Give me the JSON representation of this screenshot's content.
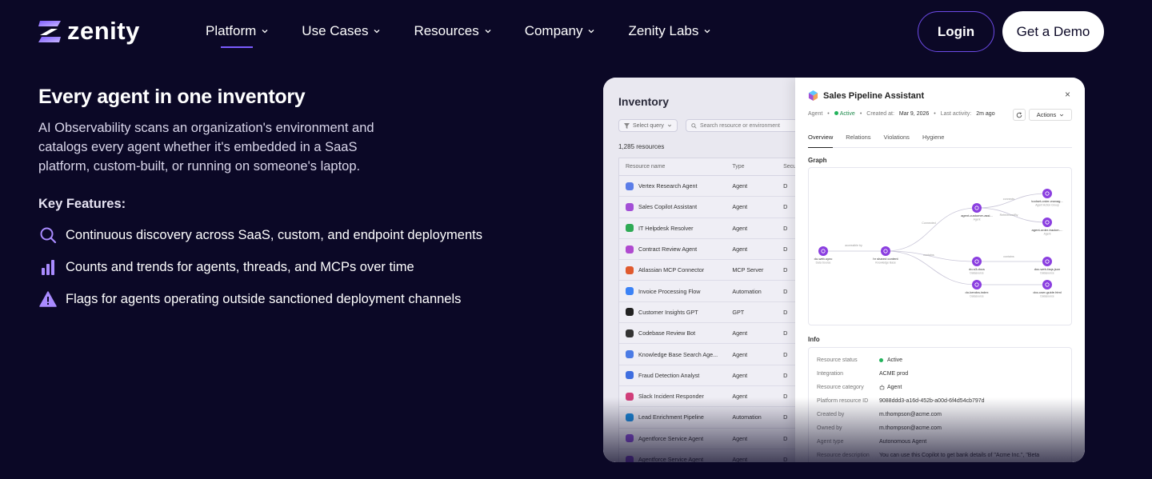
{
  "brand": {
    "name": "zenity"
  },
  "nav": {
    "items": [
      {
        "label": "Platform"
      },
      {
        "label": "Use Cases"
      },
      {
        "label": "Resources"
      },
      {
        "label": "Company"
      },
      {
        "label": "Zenity Labs"
      }
    ],
    "login_label": "Login",
    "demo_label": "Get a Demo"
  },
  "hero": {
    "title": "Every agent in one inventory",
    "description": "AI Observability scans an organization's environment and catalogs every agent whether it's embedded in a SaaS platform, custom-built, or running on someone's laptop.",
    "key_features_title": "Key Features:",
    "features": [
      {
        "icon": "search-icon",
        "text": "Continuous discovery across SaaS, custom, and endpoint deployments"
      },
      {
        "icon": "bar-chart-icon",
        "text": "Counts and trends for agents, threads, and MCPs over time"
      },
      {
        "icon": "warning-icon",
        "text": "Flags for agents operating outside sanctioned deployment channels"
      }
    ]
  },
  "inventory": {
    "title": "Inventory",
    "filter_label": "Select query",
    "search_placeholder": "Search resource or environment",
    "count": "1,285 resources",
    "columns": {
      "name": "Resource name",
      "type": "Type",
      "sec": "Secu"
    },
    "rows": [
      {
        "name": "Vertex Research Agent",
        "type": "Agent",
        "sec": "D",
        "color": "#5b7de8"
      },
      {
        "name": "Sales Copilot Assistant",
        "type": "Agent",
        "sec": "D",
        "color": "#a34fd6"
      },
      {
        "name": "IT Helpdesk Resolver",
        "type": "Agent",
        "sec": "D",
        "color": "#2faa55"
      },
      {
        "name": "Contract Review Agent",
        "type": "Agent",
        "sec": "D",
        "color": "#b04ad0"
      },
      {
        "name": "Atlassian MCP Connector",
        "type": "MCP Server",
        "sec": "D",
        "color": "#e05a2e"
      },
      {
        "name": "Invoice Processing Flow",
        "type": "Automation",
        "sec": "D",
        "color": "#3b82f6"
      },
      {
        "name": "Customer Insights GPT",
        "type": "GPT",
        "sec": "D",
        "color": "#222222"
      },
      {
        "name": "Codebase Review Bot",
        "type": "Agent",
        "sec": "D",
        "color": "#333333"
      },
      {
        "name": "Knowledge Base Search Age...",
        "type": "Agent",
        "sec": "D",
        "color": "#4b7be5"
      },
      {
        "name": "Fraud Detection Analyst",
        "type": "Agent",
        "sec": "D",
        "color": "#3f6ee0"
      },
      {
        "name": "Slack Incident Responder",
        "type": "Agent",
        "sec": "D",
        "color": "#d13f7a"
      },
      {
        "name": "Lead Enrichment Pipeline",
        "type": "Automation",
        "sec": "D",
        "color": "#1c8adb"
      },
      {
        "name": "Agentforce Service Agent",
        "type": "Agent",
        "sec": "D",
        "color": "#8a4fd8"
      },
      {
        "name": "Agentforce Service Agent",
        "type": "Agent",
        "sec": "D",
        "color": "#8a4fd8"
      }
    ]
  },
  "detail": {
    "title": "Sales Pipeline Assistant",
    "close": "×",
    "meta": {
      "kind": "Agent",
      "status": "Active",
      "created_label": "Created at:",
      "created": "Mar 9, 2026",
      "activity_label": "Last activity:",
      "activity": "2m ago"
    },
    "actions_label": "Actions",
    "tabs": [
      "Overview",
      "Relations",
      "Violations",
      "Hygiene"
    ],
    "graph_label": "Graph",
    "graph_nodes": [
      {
        "title": "do-web-sync",
        "sub": "Data Source"
      },
      {
        "title": "hr shared content",
        "sub": "Knowledge Base"
      },
      {
        "title": "agent-customer-assi...",
        "sub": "Agent"
      },
      {
        "title": "toolset-order-manag...",
        "sub": "Agent Action Group"
      },
      {
        "title": "agent-order-tracker-...",
        "sub": "Agent"
      },
      {
        "title": "do-s3-docs",
        "sub": "Datasource"
      },
      {
        "title": "doc-web-faqs.json",
        "sub": "Datasource"
      },
      {
        "title": "do-kendra-index",
        "sub": "Datasource"
      },
      {
        "title": "doc-user-guide.html",
        "sub": "Datasource"
      }
    ],
    "graph_edges": [
      "accessible by",
      "Connected",
      "connects",
      "ReferencedBy",
      "contains",
      "contains"
    ],
    "info_label": "Info",
    "info": [
      {
        "k": "Resource status",
        "v": "Active"
      },
      {
        "k": "Integration",
        "v": "ACME prod"
      },
      {
        "k": "Resource category",
        "v": "Agent"
      },
      {
        "k": "Platform resource ID",
        "v": "9088ddd3-a16d-452b-a00d-6f4d54cb797d"
      },
      {
        "k": "Created by",
        "v": "m.thompson@acme.com"
      },
      {
        "k": "Owned by",
        "v": "m.thompson@acme.com"
      },
      {
        "k": "Agent type",
        "v": "Autonomous Agent"
      },
      {
        "k": "Resource description",
        "v": "You can use this Copilot to get bank details of \"Acme Inc.\", \"Beta"
      }
    ]
  },
  "colors": {
    "accent": "#7b5cff",
    "background": "#0b0826",
    "icon": "#a98bff"
  }
}
